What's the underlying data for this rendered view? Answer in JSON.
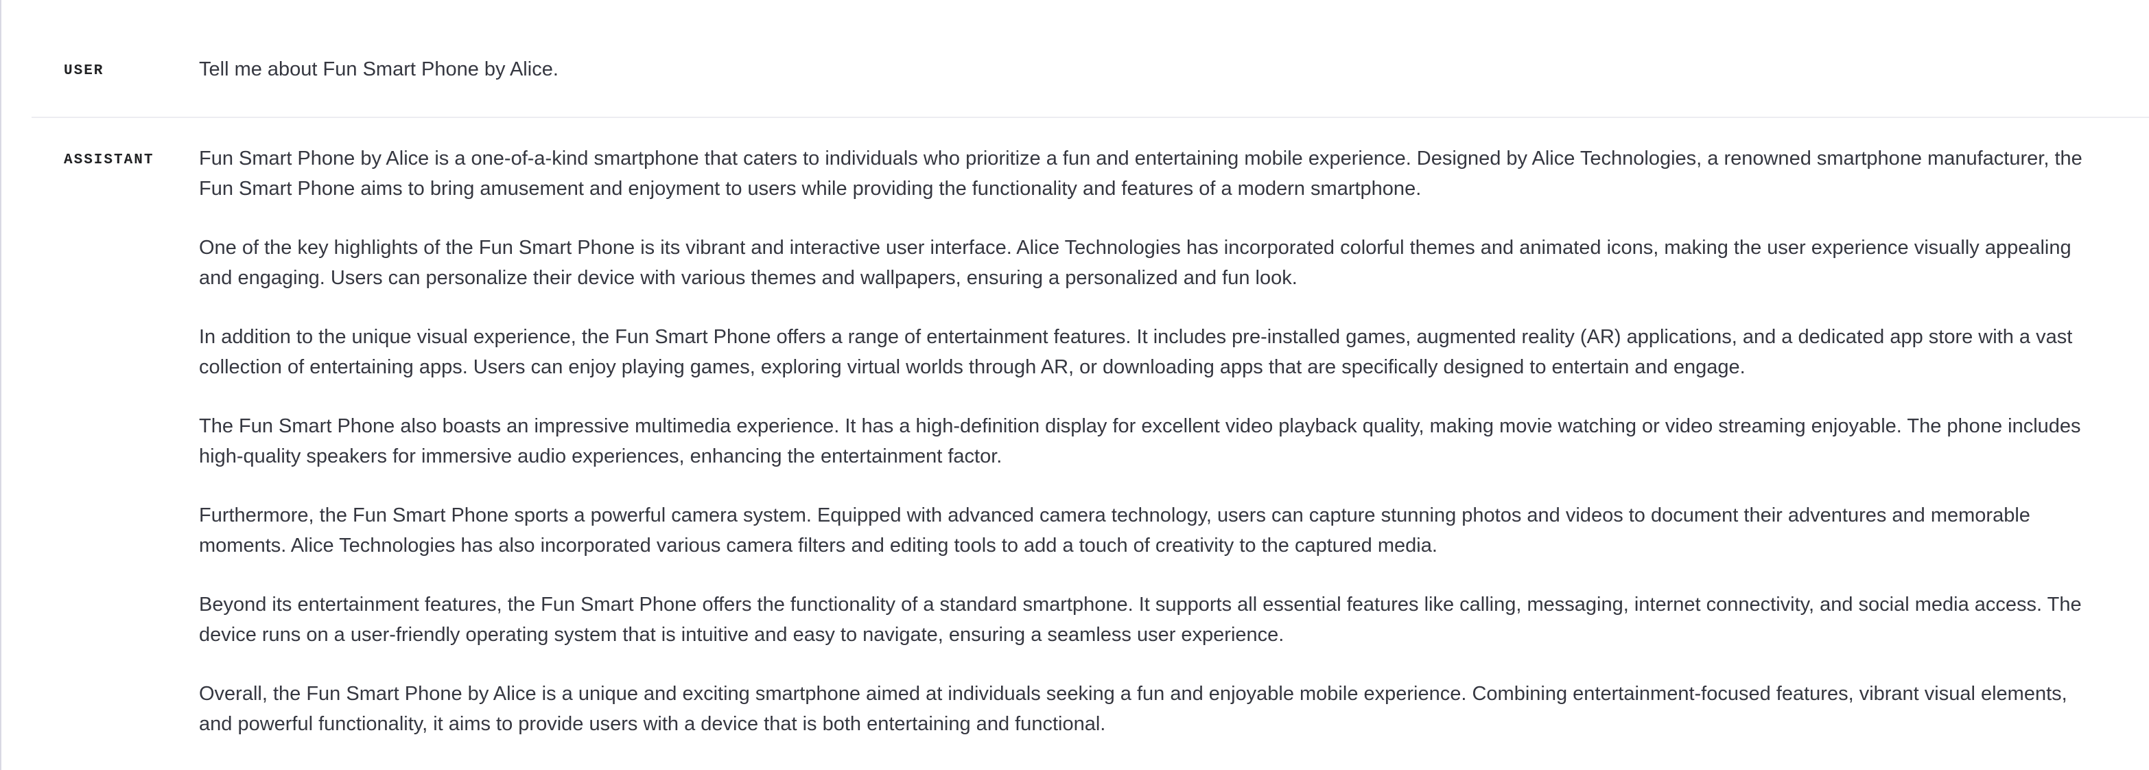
{
  "conversation": {
    "user": {
      "role_label": "USER",
      "text": "Tell me about Fun Smart Phone by Alice."
    },
    "assistant": {
      "role_label": "ASSISTANT",
      "paragraphs": [
        "Fun Smart Phone by Alice is a one-of-a-kind smartphone that caters to individuals who prioritize a fun and entertaining mobile experience. Designed by Alice Technologies, a renowned smartphone manufacturer, the Fun Smart Phone aims to bring amusement and enjoyment to users while providing the functionality and features of a modern smartphone.",
        "One of the key highlights of the Fun Smart Phone is its vibrant and interactive user interface. Alice Technologies has incorporated colorful themes and animated icons, making the user experience visually appealing and engaging. Users can personalize their device with various themes and wallpapers, ensuring a personalized and fun look.",
        "In addition to the unique visual experience, the Fun Smart Phone offers a range of entertainment features. It includes pre-installed games, augmented reality (AR) applications, and a dedicated app store with a vast collection of entertaining apps. Users can enjoy playing games, exploring virtual worlds through AR, or downloading apps that are specifically designed to entertain and engage.",
        "The Fun Smart Phone also boasts an impressive multimedia experience. It has a high-definition display for excellent video playback quality, making movie watching or video streaming enjoyable. The phone includes high-quality speakers for immersive audio experiences, enhancing the entertainment factor.",
        "Furthermore, the Fun Smart Phone sports a powerful camera system. Equipped with advanced camera technology, users can capture stunning photos and videos to document their adventures and memorable moments. Alice Technologies has also incorporated various camera filters and editing tools to add a touch of creativity to the captured media.",
        "Beyond its entertainment features, the Fun Smart Phone offers the functionality of a standard smartphone. It supports all essential features like calling, messaging, internet connectivity, and social media access. The device runs on a user-friendly operating system that is intuitive and easy to navigate, ensuring a seamless user experience.",
        "Overall, the Fun Smart Phone by Alice is a unique and exciting smartphone aimed at individuals seeking a fun and enjoyable mobile experience. Combining entertainment-focused features, vibrant visual elements, and powerful functionality, it aims to provide users with a device that is both entertaining and functional."
      ]
    }
  }
}
